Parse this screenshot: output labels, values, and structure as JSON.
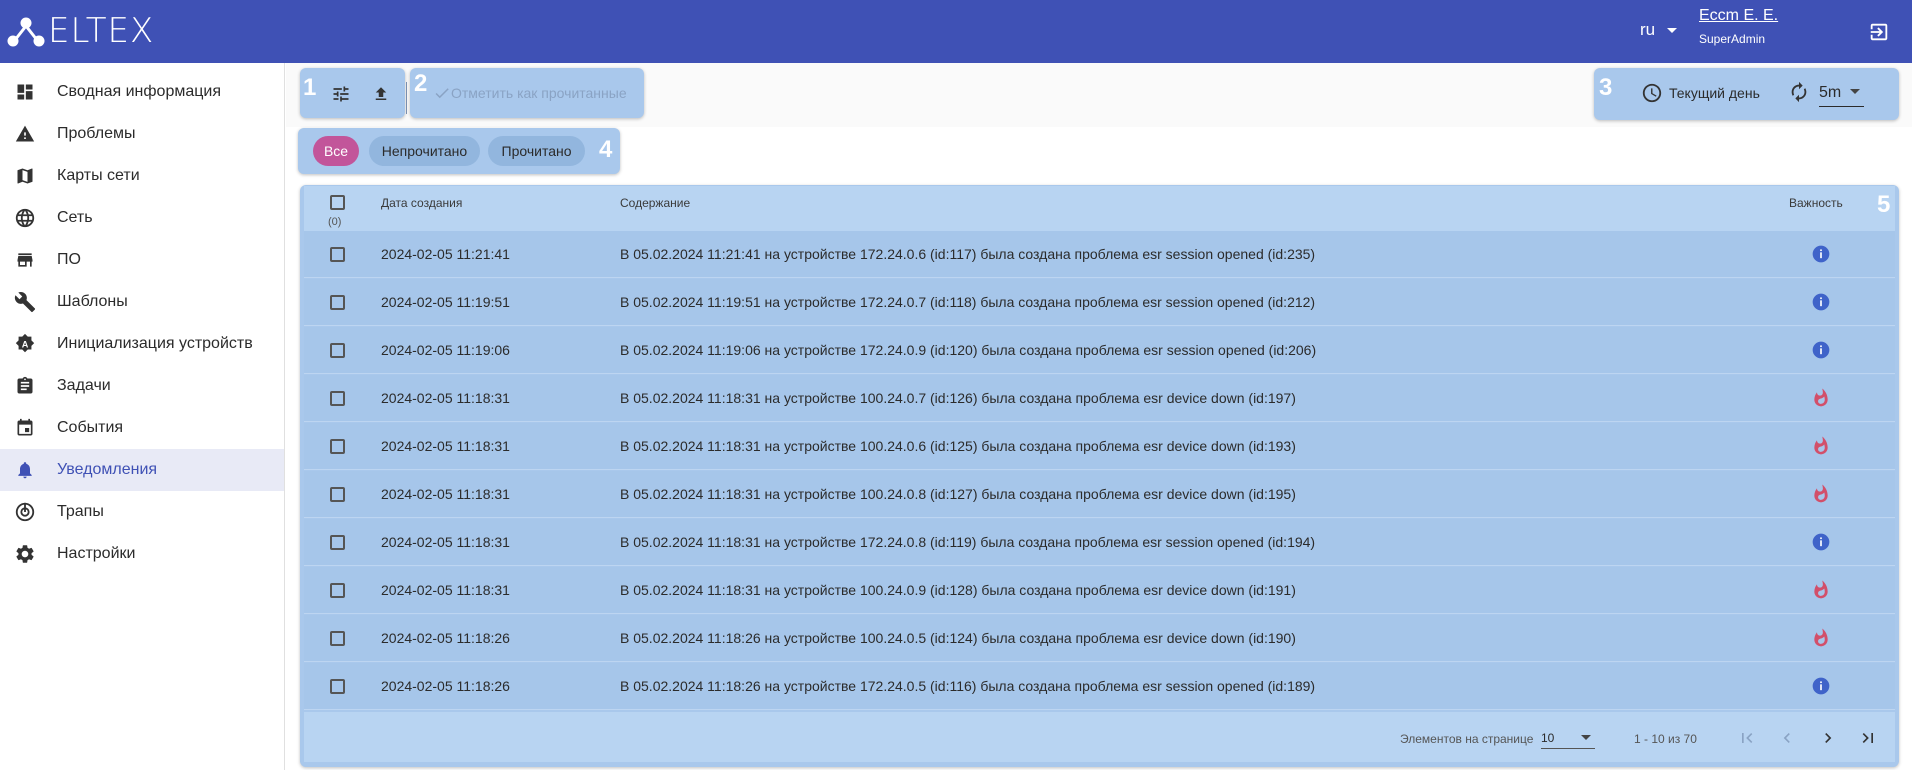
{
  "header": {
    "logo_text": "ELTEX",
    "language": "ru",
    "user_name": "Еcсm Е. Е.",
    "user_role": "SuperAdmin"
  },
  "sidebar": {
    "items": [
      {
        "label": "Сводная информация",
        "icon": "dashboard-icon"
      },
      {
        "label": "Проблемы",
        "icon": "warning-icon"
      },
      {
        "label": "Карты сети",
        "icon": "map-icon"
      },
      {
        "label": "Сеть",
        "icon": "globe-icon"
      },
      {
        "label": "ПО",
        "icon": "store-icon"
      },
      {
        "label": "Шаблоны",
        "icon": "wrench-icon"
      },
      {
        "label": "Инициализация устройств",
        "icon": "auto-setup-icon"
      },
      {
        "label": "Задачи",
        "icon": "clipboard-icon"
      },
      {
        "label": "События",
        "icon": "calendar-icon"
      },
      {
        "label": "Уведомления",
        "icon": "bell-icon",
        "active": true
      },
      {
        "label": "Трапы",
        "icon": "trap-icon"
      },
      {
        "label": "Настройки",
        "icon": "gear-icon"
      }
    ]
  },
  "toolbar": {
    "mark_read_label": "Отметить как прочитанные",
    "period_label": "Текущий день",
    "refresh_interval": "5m"
  },
  "callouts": [
    "1",
    "2",
    "3",
    "4",
    "5"
  ],
  "filters": {
    "all": "Все",
    "unread": "Непрочитано",
    "read": "Прочитано"
  },
  "table": {
    "columns": {
      "date": "Дата создания",
      "content": "Содержание",
      "severity": "Важность"
    },
    "selected_count": "(0)",
    "rows": [
      {
        "date": "2024-02-05 11:21:41",
        "content": "В 05.02.2024 11:21:41 на устройстве 172.24.0.6 (id:117) была создана проблема esr session opened (id:235)",
        "severity": "info"
      },
      {
        "date": "2024-02-05 11:19:51",
        "content": "В 05.02.2024 11:19:51 на устройстве 172.24.0.7 (id:118) была создана проблема esr session opened (id:212)",
        "severity": "info"
      },
      {
        "date": "2024-02-05 11:19:06",
        "content": "В 05.02.2024 11:19:06 на устройстве 172.24.0.9 (id:120) была создана проблема esr session opened (id:206)",
        "severity": "info"
      },
      {
        "date": "2024-02-05 11:18:31",
        "content": "В 05.02.2024 11:18:31 на устройстве 100.24.0.7 (id:126) была создана проблема esr device down (id:197)",
        "severity": "critical"
      },
      {
        "date": "2024-02-05 11:18:31",
        "content": "В 05.02.2024 11:18:31 на устройстве 100.24.0.6 (id:125) была создана проблема esr device down (id:193)",
        "severity": "critical"
      },
      {
        "date": "2024-02-05 11:18:31",
        "content": "В 05.02.2024 11:18:31 на устройстве 100.24.0.8 (id:127) была создана проблема esr device down (id:195)",
        "severity": "critical"
      },
      {
        "date": "2024-02-05 11:18:31",
        "content": "В 05.02.2024 11:18:31 на устройстве 172.24.0.8 (id:119) была создана проблема esr session opened (id:194)",
        "severity": "info"
      },
      {
        "date": "2024-02-05 11:18:31",
        "content": "В 05.02.2024 11:18:31 на устройстве 100.24.0.9 (id:128) была создана проблема esr device down (id:191)",
        "severity": "critical"
      },
      {
        "date": "2024-02-05 11:18:26",
        "content": "В 05.02.2024 11:18:26 на устройстве 100.24.0.5 (id:124) была создана проблема esr device down (id:190)",
        "severity": "critical"
      },
      {
        "date": "2024-02-05 11:18:26",
        "content": "В 05.02.2024 11:18:26 на устройстве 172.24.0.5 (id:116) была создана проблема esr session opened (id:189)",
        "severity": "info"
      }
    ]
  },
  "pagination": {
    "per_page_label": "Элементов на странице",
    "per_page": "10",
    "range": "1 - 10 из 70"
  },
  "colors": {
    "header": "#3f51b5",
    "panel": "#a9c8ec",
    "chip_active": "#c2559a",
    "info": "#3f63c9",
    "critical": "#d24f6a"
  }
}
